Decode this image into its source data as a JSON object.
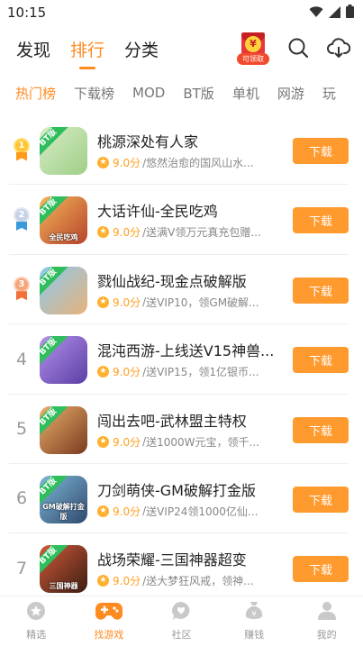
{
  "status_bar": {
    "time": "10:15"
  },
  "top_nav": {
    "tabs": [
      "发现",
      "排行",
      "分类"
    ],
    "active_tab": 1,
    "promo_tag": "可领取",
    "promo_coin": "¥"
  },
  "categories": {
    "items": [
      "热门榜",
      "下载榜",
      "MOD",
      "BT版",
      "单机",
      "网游",
      "玩"
    ],
    "active": 0
  },
  "games": [
    {
      "rank": "1",
      "medal": "gold",
      "title": "桃源深处有人家",
      "score": "9.0分",
      "desc": "悠然治愈的国风山水...",
      "bt": "BT版",
      "cap": "",
      "download": "下载",
      "colors": [
        "#d7ecc8",
        "#9fcf86"
      ]
    },
    {
      "rank": "2",
      "medal": "silver",
      "title": "大话许仙-全民吃鸡",
      "score": "9.0分",
      "desc": "送满V领万元真充包赠...",
      "bt": "BT版",
      "cap": "全民吃鸡",
      "download": "下载",
      "colors": [
        "#f6b65a",
        "#b5432b"
      ]
    },
    {
      "rank": "3",
      "medal": "bronze",
      "title": "戮仙战纪-现金点破解版",
      "score": "9.0分",
      "desc": "送VIP10，领GM破解...",
      "bt": "BT版",
      "cap": "",
      "download": "下载",
      "colors": [
        "#8ccaf0",
        "#e6b27a"
      ]
    },
    {
      "rank": "4",
      "medal": "",
      "title": "混沌西游-上线送V15神兽...",
      "score": "9.0分",
      "desc": "送VIP15，领1亿银币...",
      "bt": "BT版",
      "cap": "",
      "download": "下载",
      "colors": [
        "#b592ea",
        "#5a3ea6"
      ]
    },
    {
      "rank": "5",
      "medal": "",
      "title": "闯出去吧-武林盟主特权",
      "score": "9.0分",
      "desc": "送1000W元宝，领千...",
      "bt": "BT版",
      "cap": "",
      "download": "下载",
      "colors": [
        "#e7b06a",
        "#7a3a20"
      ]
    },
    {
      "rank": "6",
      "medal": "",
      "title": "刀剑萌侠-GM破解打金版",
      "score": "9.0分",
      "desc": "送VIP24领1000亿仙...",
      "bt": "BT版",
      "cap": "GM破解打金版",
      "download": "下载",
      "colors": [
        "#7fb7d8",
        "#2f4a6e"
      ]
    },
    {
      "rank": "7",
      "medal": "",
      "title": "战场荣耀-三国神器超变",
      "score": "9.0分",
      "desc": "送大梦狂风戒，领神...",
      "bt": "BT版",
      "cap": "三国神器",
      "download": "下载",
      "colors": [
        "#d15a3a",
        "#3b1d12"
      ]
    }
  ],
  "bottom_tabs": {
    "items": [
      "精选",
      "找游戏",
      "社区",
      "赚钱",
      "我的"
    ],
    "active": 1
  },
  "colors": {
    "accent": "#ff8a1f",
    "download_button": "#ff9a2e",
    "bt_tag": "#2fbd5e"
  }
}
